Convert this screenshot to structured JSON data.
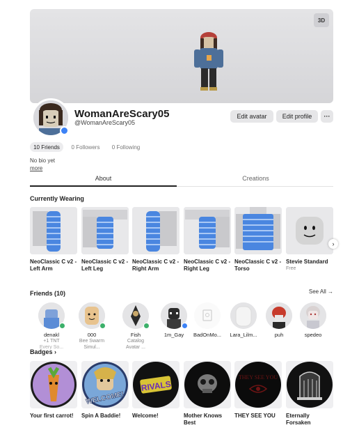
{
  "banner": {
    "view_3d_label": "3D"
  },
  "profile": {
    "display_name": "WomanAreScary05",
    "username": "@WomanAreScary05",
    "edit_avatar_label": "Edit avatar",
    "edit_profile_label": "Edit profile",
    "more_label": "···",
    "stats": [
      {
        "label": "10 Friends"
      },
      {
        "label": "0 Followers"
      },
      {
        "label": "0 Following"
      }
    ],
    "bio": "No bio yet",
    "bio_more": "more"
  },
  "tabs": [
    {
      "label": "About"
    },
    {
      "label": "Creations"
    }
  ],
  "currently_wearing": {
    "title": "Currently Wearing",
    "items": [
      {
        "name": "NeoClassic C v2 - Left Arm",
        "sub": ""
      },
      {
        "name": "NeoClassic C v2 - Left Leg",
        "sub": ""
      },
      {
        "name": "NeoClassic C v2 - Right Arm",
        "sub": ""
      },
      {
        "name": "NeoClassic C v2 - Right Leg",
        "sub": ""
      },
      {
        "name": "NeoClassic C v2 - Torso",
        "sub": ""
      },
      {
        "name": "Stevie Standard",
        "sub": "Free"
      }
    ],
    "next_label": "›"
  },
  "friends": {
    "title": "Friends (10)",
    "see_all": "See All →",
    "list": [
      {
        "name": "denakl",
        "sub": "+1 TNT",
        "sub2": "Every So...",
        "status": "game"
      },
      {
        "name": "000",
        "sub": "Bee Swarm",
        "sub2": "Simul...",
        "status": "game"
      },
      {
        "name": "Fish",
        "sub": "Catalog",
        "sub2": "Avatar ...",
        "status": "game"
      },
      {
        "name": "1m_Gay",
        "sub": "",
        "sub2": "",
        "status": "online"
      },
      {
        "name": "BadOnMo...",
        "sub": "",
        "sub2": "",
        "status": "none"
      },
      {
        "name": "Lara_Lilm...",
        "sub": "",
        "sub2": "",
        "status": "none"
      },
      {
        "name": "puh",
        "sub": "",
        "sub2": "",
        "status": "none"
      },
      {
        "name": "spedeo",
        "sub": "",
        "sub2": "",
        "status": "none"
      }
    ]
  },
  "badges": {
    "title": "Badges",
    "title_arrow": "›",
    "list": [
      {
        "name": "Your first carrot!"
      },
      {
        "name": "Spin A Baddie!",
        "art_text": "WELCOME!"
      },
      {
        "name": "Welcome!",
        "art_text": "RIVALS"
      },
      {
        "name": "Mother Knows Best"
      },
      {
        "name": "THEY SEE YOU",
        "art_text": "THEY SEE YOU"
      },
      {
        "name": "Eternally Forsaken"
      }
    ]
  },
  "colors": {
    "accent_blue": "#3c82f6",
    "game_green": "#3cb06a",
    "banner_bg": "#dcdcdf",
    "button_bg": "#e6e6e8"
  }
}
